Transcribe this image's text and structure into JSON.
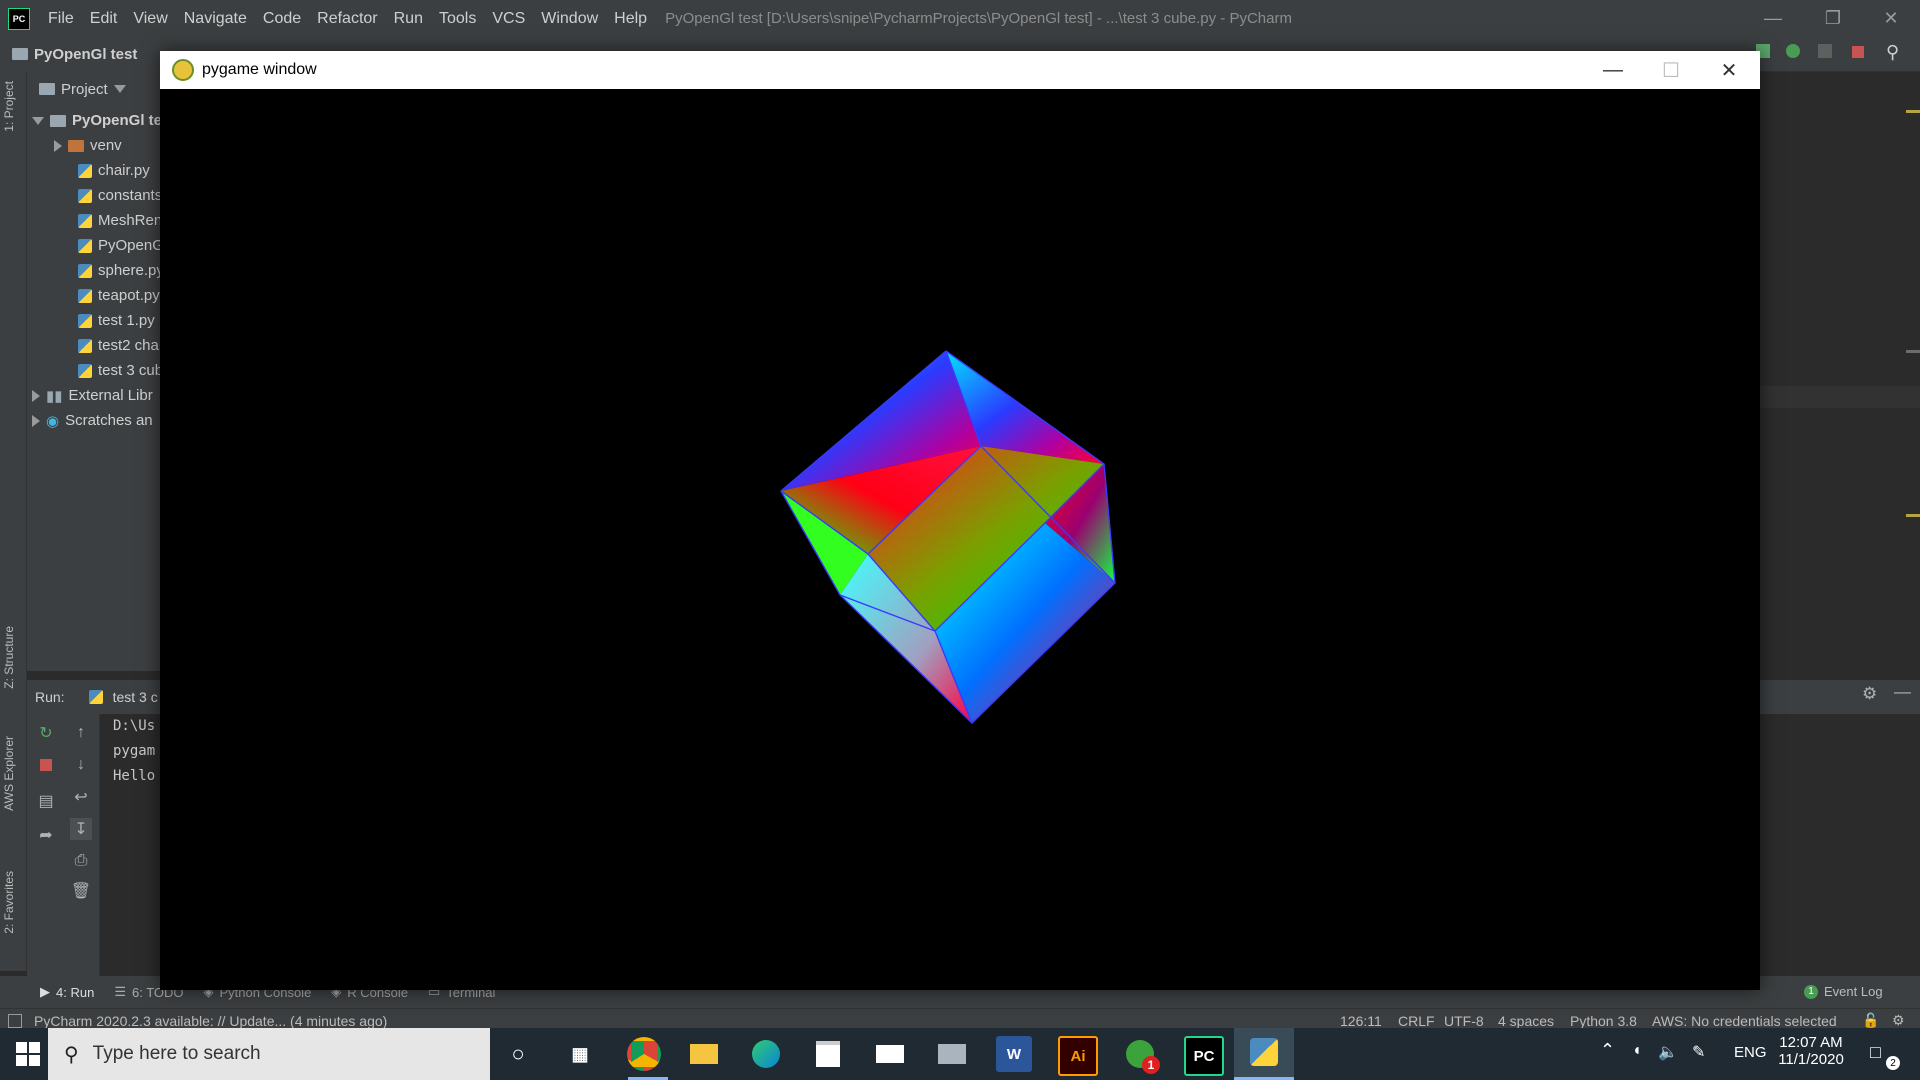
{
  "ide": {
    "menu": [
      "File",
      "Edit",
      "View",
      "Navigate",
      "Code",
      "Refactor",
      "Run",
      "Tools",
      "VCS",
      "Window",
      "Help"
    ],
    "title": "PyOpenGl test [D:\\Users\\snipe\\PycharmProjects\\PyOpenGl test] - ...\\test 3 cube.py - PyCharm",
    "breadcrumb": "PyOpenGl test",
    "project_header": "Project",
    "tree": [
      {
        "label": "PyOpenGl te",
        "kind": "root-folder"
      },
      {
        "label": "venv",
        "kind": "folder"
      },
      {
        "label": "chair.py",
        "kind": "py"
      },
      {
        "label": "constants",
        "kind": "py"
      },
      {
        "label": "MeshRen",
        "kind": "py"
      },
      {
        "label": "PyOpenG",
        "kind": "py"
      },
      {
        "label": "sphere.py",
        "kind": "py"
      },
      {
        "label": "teapot.py",
        "kind": "py"
      },
      {
        "label": "test 1.py",
        "kind": "py"
      },
      {
        "label": "test2 cha",
        "kind": "py"
      },
      {
        "label": "test 3 cub",
        "kind": "py"
      },
      {
        "label": "External Libr",
        "kind": "lib"
      },
      {
        "label": "Scratches an",
        "kind": "scratch"
      }
    ],
    "left_tabs": {
      "project": "1: Project",
      "structure": "Z: Structure",
      "aws": "AWS Explorer",
      "favorites": "2: Favorites"
    },
    "run": {
      "label": "Run:",
      "tab": "test 3 c",
      "console": [
        "D:\\Us",
        "pygam",
        "Hello"
      ]
    },
    "toolwindows": [
      "4: Run",
      "6: TODO",
      "Python Console",
      "R Console",
      "Terminal"
    ],
    "event_log": "Event Log",
    "event_count": "1",
    "status": {
      "message": "PyCharm 2020.2.3 available: // Update... (4 minutes ago)",
      "position": "126:11",
      "line_sep": "CRLF",
      "encoding": "UTF-8",
      "indent": "4 spaces",
      "interpreter": "Python 3.8",
      "aws": "AWS: No credentials selected"
    }
  },
  "pygame": {
    "title": "pygame window"
  },
  "taskbar": {
    "search_placeholder": "Type here to search",
    "time": "12:07 AM",
    "date": "11/1/2020",
    "lang": "ENG",
    "notifications": "2",
    "greenshot_badge": "1",
    "word_label": "W",
    "illustrator_label": "Ai",
    "pycharm_label": "PC",
    "apps": [
      "cortana-icon",
      "task-view-icon",
      "chrome-icon",
      "file-explorer-icon",
      "edge-icon",
      "store-icon",
      "mail-icon",
      "printer-icon",
      "word-icon",
      "illustrator-icon",
      "greenshot-icon",
      "pycharm-icon",
      "python-icon"
    ]
  },
  "colors": {
    "ide_bg": "#2b2b2b",
    "ide_panel": "#3c3f41",
    "taskbar": "#1f2a33",
    "accent": "#21d789"
  }
}
